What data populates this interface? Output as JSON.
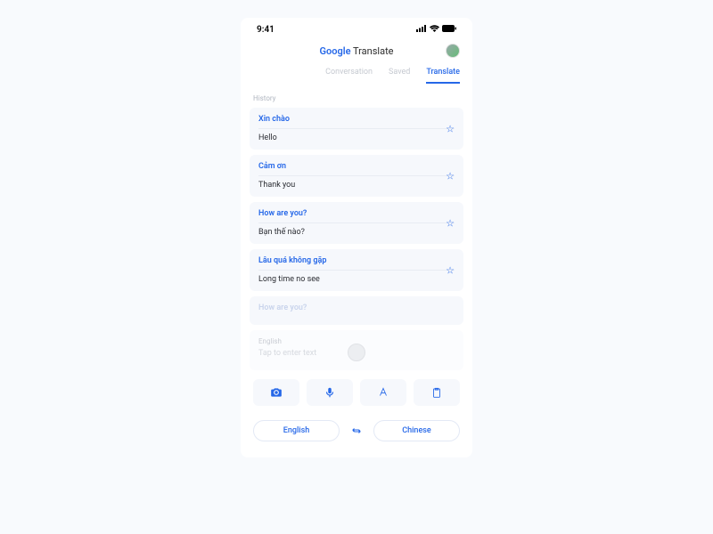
{
  "status": {
    "time": "9:41"
  },
  "header": {
    "google": "Google",
    "translate": " Translate"
  },
  "tabs": [
    {
      "label": "Conversation",
      "active": false
    },
    {
      "label": "Saved",
      "active": false
    },
    {
      "label": "Translate",
      "active": true
    }
  ],
  "history_label": "History",
  "history": [
    {
      "src": "Xin chào",
      "dst": "Hello"
    },
    {
      "src": "Cảm ơn",
      "dst": "Thank you"
    },
    {
      "src": "How are you?",
      "dst": "Bạn thế nào?"
    },
    {
      "src": "Lâu quá không gặp",
      "dst": "Long time no see"
    },
    {
      "src": "How are you?",
      "dst": ""
    }
  ],
  "input": {
    "label": "English",
    "placeholder": "Tap to enter text"
  },
  "langs": {
    "from": "English",
    "to": "Chinese"
  }
}
